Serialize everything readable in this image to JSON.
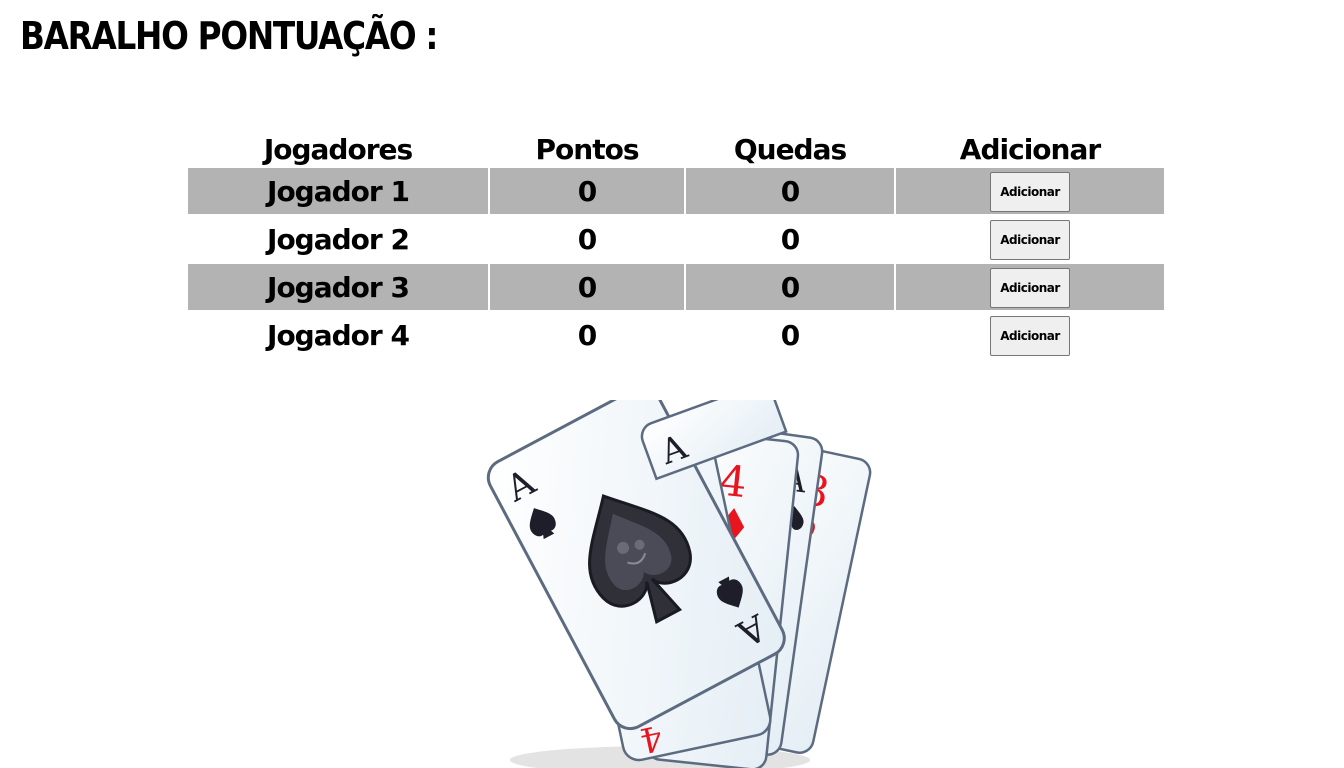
{
  "page": {
    "title": "BARALHO PONTUAÇÃO :"
  },
  "table": {
    "headers": [
      "Jogadores",
      "Pontos",
      "Quedas",
      "Adicionar"
    ],
    "rows": [
      {
        "player": "Jogador 1",
        "points": "0",
        "falls": "0",
        "button": "Adicionar",
        "shaded": true
      },
      {
        "player": "Jogador 2",
        "points": "0",
        "falls": "0",
        "button": "Adicionar",
        "shaded": false
      },
      {
        "player": "Jogador 3",
        "points": "0",
        "falls": "0",
        "button": "Adicionar",
        "shaded": true
      },
      {
        "player": "Jogador 4",
        "points": "0",
        "falls": "0",
        "button": "Adicionar",
        "shaded": false
      }
    ]
  },
  "illustration": {
    "cards": [
      {
        "rank": "3",
        "suit": "hearts",
        "color": "#e8141e"
      },
      {
        "rank": "4",
        "suit": "diamonds",
        "color": "#e8141e"
      },
      {
        "rank": "A",
        "suit": "spades",
        "color": "#1e1e2a"
      }
    ],
    "row_shade_color": "#b3b3b3"
  }
}
